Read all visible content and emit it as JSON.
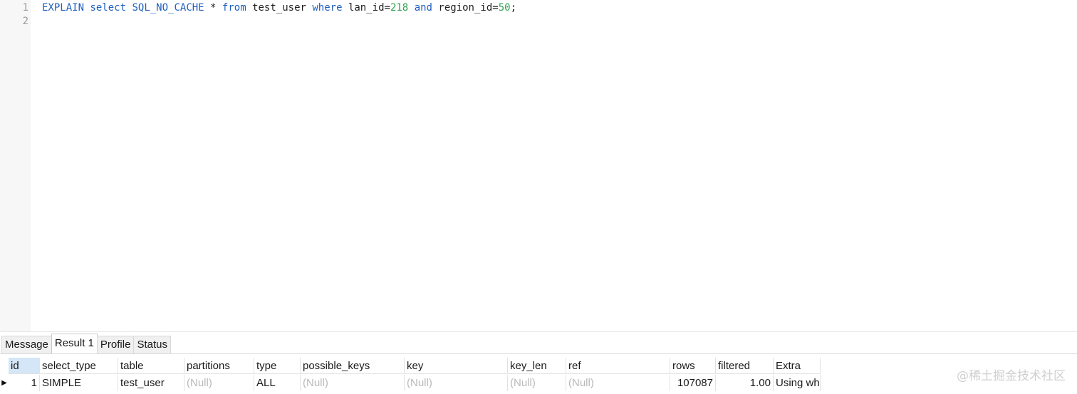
{
  "editor": {
    "line_numbers": [
      "1",
      "2"
    ],
    "line1": {
      "explain": "EXPLAIN",
      "select": "select",
      "no_cache": "SQL_NO_CACHE",
      "star": " * ",
      "from": "from",
      "table": " test_user ",
      "where": "where",
      "col1": " lan_id=",
      "val1": "218",
      "and": "and",
      "col2": " region_id=",
      "val2": "50",
      "end": ";"
    }
  },
  "tabs": [
    "Message",
    "Result 1",
    "Profile",
    "Status"
  ],
  "active_tab": "Result 1",
  "result": {
    "columns": [
      "id",
      "select_type",
      "table",
      "partitions",
      "type",
      "possible_keys",
      "key",
      "key_len",
      "ref",
      "rows",
      "filtered",
      "Extra"
    ],
    "row": {
      "marker": "▶",
      "id": "1",
      "select_type": "SIMPLE",
      "table": "test_user",
      "partitions": "(Null)",
      "type": "ALL",
      "possible_keys": "(Null)",
      "key": "(Null)",
      "key_len": "(Null)",
      "ref": "(Null)",
      "rows": "107087",
      "filtered": "1.00",
      "extra": "Using wh"
    }
  },
  "watermark": "@稀土掘金技术社区",
  "colors": {
    "keyword": "#1f5fbf",
    "number": "#2ea44f",
    "null_text": "#b9b9b9",
    "selected_header": "#d4e6f7"
  }
}
